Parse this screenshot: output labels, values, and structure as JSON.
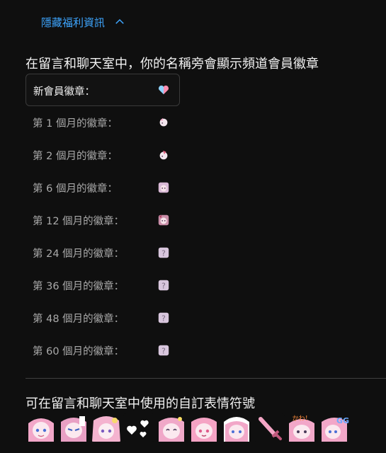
{
  "toggle": {
    "label": "隱藏福利資訊",
    "icon": "chevron-up-icon",
    "color": "#3ea6ff"
  },
  "perk_description": "在留言和聊天室中，你的名稱旁會顯示頻道會員徽章",
  "badges": [
    {
      "label": "新會員徽章：",
      "icon": "heart-badge-icon",
      "selected": true
    },
    {
      "label": "第 1 個月的徽章：",
      "icon": "character-badge-icon",
      "selected": false
    },
    {
      "label": "第 2 個月的徽章：",
      "icon": "character-badge-icon",
      "selected": false
    },
    {
      "label": "第 6 個月的徽章：",
      "icon": "character-badge-icon",
      "selected": false
    },
    {
      "label": "第 12 個月的徽章：",
      "icon": "character-badge-icon",
      "selected": false
    },
    {
      "label": "第 24 個月的徽章：",
      "icon": "unknown-badge-icon",
      "selected": false
    },
    {
      "label": "第 36 個月的徽章：",
      "icon": "unknown-badge-icon",
      "selected": false
    },
    {
      "label": "第 48 個月的徽章：",
      "icon": "unknown-badge-icon",
      "selected": false
    },
    {
      "label": "第 60 個月的徽章：",
      "icon": "unknown-badge-icon",
      "selected": false
    }
  ],
  "emoji_section": {
    "title": "可在留言和聊天室中使用的自訂表情符號",
    "emojis": [
      "character-emoji-icon",
      "character-emoji-icon",
      "character-emoji-icon",
      "hearts-emoji-icon",
      "character-emoji-icon",
      "character-emoji-icon",
      "character-emoji-icon",
      "sword-emoji-icon",
      "character-emoji-icon",
      "character-emoji-icon"
    ],
    "emoji_text": {
      "8": "かわ！",
      "9": "GG"
    }
  },
  "colors": {
    "background": "#0f0f0f",
    "accent_pink": "#f4a6c6",
    "accent_blue": "#3ea6ff"
  }
}
